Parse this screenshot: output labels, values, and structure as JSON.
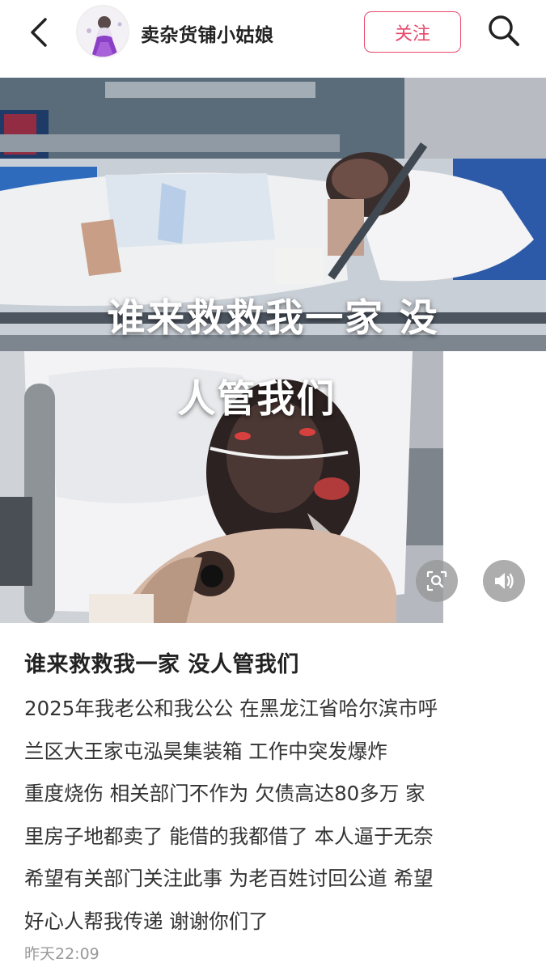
{
  "header": {
    "author_name": "卖杂货铺小姑娘",
    "follow_label": "关注"
  },
  "media": {
    "overlay_line1": "谁来救救我一家 没",
    "overlay_line2": "人管我们"
  },
  "post": {
    "title": "谁来救救我一家 没人管我们",
    "body_lines": [
      "2025年我老公和我公公 在黑龙江省哈尔滨市呼",
      "兰区大王家屯泓昊集装箱 工作中突发爆炸",
      "重度烧伤 相关部门不作为 欠债高达80多万 家",
      "里房子地都卖了 能借的我都借了 本人逼于无奈",
      "希望有关部门关注此事 为老百姓讨回公道 希望",
      "好心人帮我传递 谢谢你们了"
    ],
    "timestamp": "昨天22:09"
  },
  "icons": {
    "back": "chevron-left-icon",
    "search": "search-icon",
    "zoom": "image-search-icon",
    "sound": "speaker-icon"
  },
  "colors": {
    "accent": "#e9476a",
    "timestamp": "#999999"
  }
}
